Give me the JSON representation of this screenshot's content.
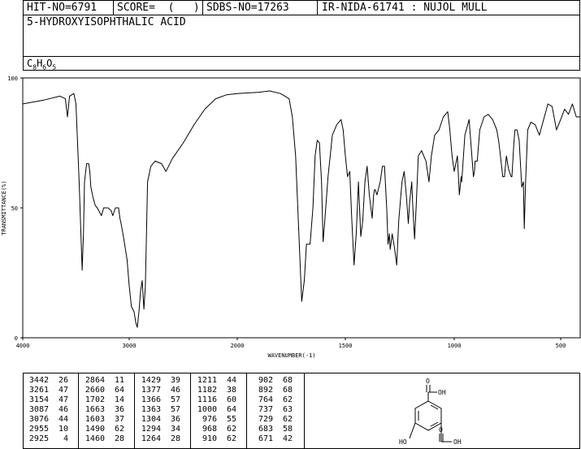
{
  "header": {
    "hit_no": "HIT-NO=6791",
    "score": "SCORE=  (   )",
    "sdbs_no": "SDBS-NO=17263",
    "ir_code": "IR-NIDA-61741 : NUJOL MULL",
    "compound_name": "5-HYDROXYISOPHTHALIC ACID",
    "formula_parts": [
      "C",
      "8",
      "H",
      "6",
      "O",
      "5"
    ]
  },
  "chart_data": {
    "type": "line",
    "xlabel": "WAVENUMBER(-1)",
    "ylabel": "TRANSMITTANCE(%)",
    "xlim": [
      4000,
      400
    ],
    "ylim": [
      0,
      100
    ],
    "x_ticks": [
      4000,
      3000,
      2000,
      1500,
      1000,
      500
    ],
    "y_ticks": [
      0,
      50,
      100
    ],
    "series": [
      {
        "color": "#000000",
        "points": [
          [
            4000,
            90
          ],
          [
            3800,
            91.5
          ],
          [
            3650,
            93
          ],
          [
            3600,
            92
          ],
          [
            3580,
            85
          ],
          [
            3560,
            93
          ],
          [
            3520,
            94
          ],
          [
            3500,
            90
          ],
          [
            3470,
            60
          ],
          [
            3442,
            26
          ],
          [
            3430,
            40
          ],
          [
            3420,
            60
          ],
          [
            3400,
            67
          ],
          [
            3380,
            67
          ],
          [
            3370,
            64
          ],
          [
            3360,
            58
          ],
          [
            3340,
            54
          ],
          [
            3320,
            51
          ],
          [
            3300,
            50
          ],
          [
            3261,
            47
          ],
          [
            3240,
            50
          ],
          [
            3200,
            50
          ],
          [
            3170,
            49
          ],
          [
            3154,
            47
          ],
          [
            3130,
            50
          ],
          [
            3100,
            50
          ],
          [
            3087,
            46
          ],
          [
            3076,
            44
          ],
          [
            3050,
            38
          ],
          [
            3020,
            30
          ],
          [
            3000,
            20
          ],
          [
            2980,
            12
          ],
          [
            2955,
            10
          ],
          [
            2940,
            6
          ],
          [
            2925,
            4
          ],
          [
            2910,
            10
          ],
          [
            2895,
            18
          ],
          [
            2880,
            22
          ],
          [
            2864,
            11
          ],
          [
            2850,
            20
          ],
          [
            2830,
            60
          ],
          [
            2800,
            66
          ],
          [
            2760,
            68
          ],
          [
            2700,
            67
          ],
          [
            2660,
            64
          ],
          [
            2600,
            69
          ],
          [
            2500,
            75
          ],
          [
            2400,
            82
          ],
          [
            2300,
            88
          ],
          [
            2200,
            92
          ],
          [
            2100,
            93.5
          ],
          [
            2000,
            94
          ],
          [
            1900,
            94.5
          ],
          [
            1850,
            95
          ],
          [
            1800,
            94
          ],
          [
            1760,
            92
          ],
          [
            1745,
            85
          ],
          [
            1730,
            70
          ],
          [
            1715,
            40
          ],
          [
            1702,
            14
          ],
          [
            1690,
            22
          ],
          [
            1680,
            36
          ],
          [
            1663,
            36
          ],
          [
            1650,
            50
          ],
          [
            1640,
            70
          ],
          [
            1630,
            76
          ],
          [
            1620,
            75
          ],
          [
            1610,
            60
          ],
          [
            1603,
            37
          ],
          [
            1595,
            45
          ],
          [
            1580,
            62
          ],
          [
            1560,
            78
          ],
          [
            1540,
            82
          ],
          [
            1520,
            84
          ],
          [
            1510,
            80
          ],
          [
            1500,
            70
          ],
          [
            1490,
            62
          ],
          [
            1480,
            64
          ],
          [
            1470,
            45
          ],
          [
            1460,
            28
          ],
          [
            1450,
            40
          ],
          [
            1440,
            60
          ],
          [
            1429,
            39
          ],
          [
            1420,
            45
          ],
          [
            1410,
            60
          ],
          [
            1400,
            66
          ],
          [
            1390,
            55
          ],
          [
            1377,
            46
          ],
          [
            1370,
            55
          ],
          [
            1366,
            57
          ],
          [
            1363,
            57
          ],
          [
            1355,
            55
          ],
          [
            1340,
            60
          ],
          [
            1330,
            66
          ],
          [
            1320,
            66
          ],
          [
            1310,
            50
          ],
          [
            1304,
            36
          ],
          [
            1298,
            40
          ],
          [
            1294,
            34
          ],
          [
            1285,
            40
          ],
          [
            1275,
            35
          ],
          [
            1264,
            28
          ],
          [
            1255,
            45
          ],
          [
            1240,
            60
          ],
          [
            1230,
            64
          ],
          [
            1220,
            55
          ],
          [
            1211,
            44
          ],
          [
            1205,
            52
          ],
          [
            1195,
            60
          ],
          [
            1190,
            50
          ],
          [
            1182,
            38
          ],
          [
            1175,
            50
          ],
          [
            1165,
            70
          ],
          [
            1150,
            72
          ],
          [
            1130,
            68
          ],
          [
            1116,
            60
          ],
          [
            1105,
            70
          ],
          [
            1090,
            78
          ],
          [
            1070,
            80
          ],
          [
            1050,
            85
          ],
          [
            1030,
            87
          ],
          [
            1020,
            80
          ],
          [
            1010,
            70
          ],
          [
            1000,
            64
          ],
          [
            995,
            66
          ],
          [
            985,
            70
          ],
          [
            976,
            55
          ],
          [
            970,
            60
          ],
          [
            968,
            62
          ],
          [
            965,
            60
          ],
          [
            950,
            78
          ],
          [
            930,
            84
          ],
          [
            910,
            62
          ],
          [
            905,
            64
          ],
          [
            902,
            68
          ],
          [
            892,
            68
          ],
          [
            880,
            80
          ],
          [
            860,
            85
          ],
          [
            840,
            86
          ],
          [
            820,
            84
          ],
          [
            800,
            80
          ],
          [
            790,
            75
          ],
          [
            780,
            68
          ],
          [
            772,
            62
          ],
          [
            764,
            62
          ],
          [
            755,
            70
          ],
          [
            745,
            65
          ],
          [
            737,
            63
          ],
          [
            733,
            62
          ],
          [
            729,
            62
          ],
          [
            720,
            75
          ],
          [
            715,
            80
          ],
          [
            705,
            80
          ],
          [
            695,
            76
          ],
          [
            683,
            58
          ],
          [
            675,
            60
          ],
          [
            671,
            42
          ],
          [
            665,
            60
          ],
          [
            655,
            80
          ],
          [
            640,
            83
          ],
          [
            620,
            82
          ],
          [
            600,
            78
          ],
          [
            580,
            84
          ],
          [
            560,
            90
          ],
          [
            540,
            89
          ],
          [
            520,
            80
          ],
          [
            500,
            84
          ],
          [
            480,
            88
          ],
          [
            460,
            86
          ],
          [
            440,
            90
          ],
          [
            420,
            85
          ],
          [
            400,
            85
          ]
        ]
      }
    ],
    "peak_table": {
      "columns": [
        [
          [
            3442,
            26
          ],
          [
            3261,
            47
          ],
          [
            3154,
            47
          ],
          [
            3087,
            46
          ],
          [
            3076,
            44
          ],
          [
            2955,
            10
          ],
          [
            2925,
            4
          ]
        ],
        [
          [
            2864,
            11
          ],
          [
            2660,
            64
          ],
          [
            1702,
            14
          ],
          [
            1663,
            36
          ],
          [
            1603,
            37
          ],
          [
            1490,
            62
          ],
          [
            1460,
            28
          ]
        ],
        [
          [
            1429,
            39
          ],
          [
            1377,
            46
          ],
          [
            1366,
            57
          ],
          [
            1363,
            57
          ],
          [
            1304,
            36
          ],
          [
            1294,
            34
          ],
          [
            1264,
            28
          ]
        ],
        [
          [
            1211,
            44
          ],
          [
            1182,
            38
          ],
          [
            1116,
            60
          ],
          [
            1000,
            64
          ],
          [
            976,
            55
          ],
          [
            968,
            62
          ],
          [
            910,
            62
          ]
        ],
        [
          [
            902,
            68
          ],
          [
            892,
            68
          ],
          [
            764,
            62
          ],
          [
            737,
            63
          ],
          [
            729,
            62
          ],
          [
            683,
            58
          ],
          [
            671,
            42
          ]
        ]
      ]
    },
    "structure_labels": {
      "top_o": "O",
      "top_oh": "OH",
      "bottom_o": "O",
      "bottom_oh": "OH",
      "ho": "HO"
    }
  }
}
